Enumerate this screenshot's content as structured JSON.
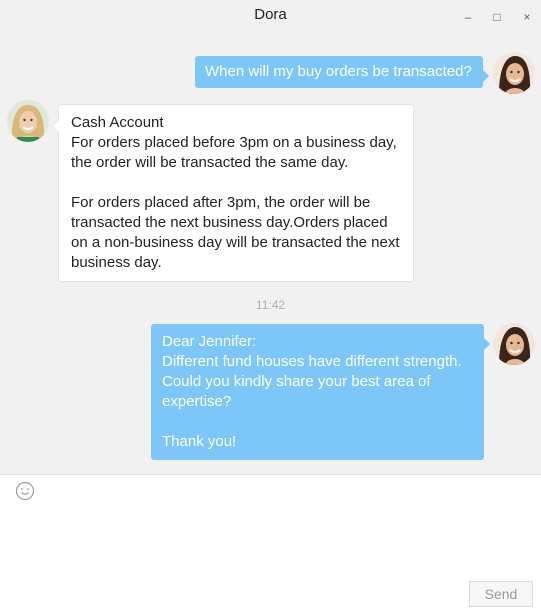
{
  "window": {
    "title": "Dora",
    "controls": {
      "minimize": "–",
      "maximize": "□",
      "close": "×"
    }
  },
  "messages": [
    {
      "direction": "outgoing",
      "avatar": "woman-dark-hair-avatar",
      "paragraphs": [
        "When will my buy orders be transacted?"
      ]
    },
    {
      "direction": "incoming",
      "avatar": "woman-blonde-avatar",
      "paragraphs": [
        "Cash Account\nFor orders placed before 3pm on a business day,\nthe order will be transacted the same day.",
        "For orders placed after 3pm, the order will be\ntransacted the next business day.Orders placed\non a non-business day will be transacted the next\nbusiness day."
      ]
    },
    {
      "type": "timestamp",
      "text": "11:42"
    },
    {
      "direction": "outgoing",
      "avatar": "woman-dark-hair-avatar",
      "paragraphs": [
        "Dear Jennifer:\nDifferent fund houses have different strength.\nCould you kindly share your best area of\nexpertise?",
        "Thank you!"
      ]
    }
  ],
  "composer": {
    "emoji_icon": "smiley-icon",
    "input_value": "",
    "send_label": "Send"
  },
  "colors": {
    "outgoing_bubble": "#7cc7f7",
    "incoming_bubble": "#ffffff",
    "background": "#f1f1f1"
  }
}
